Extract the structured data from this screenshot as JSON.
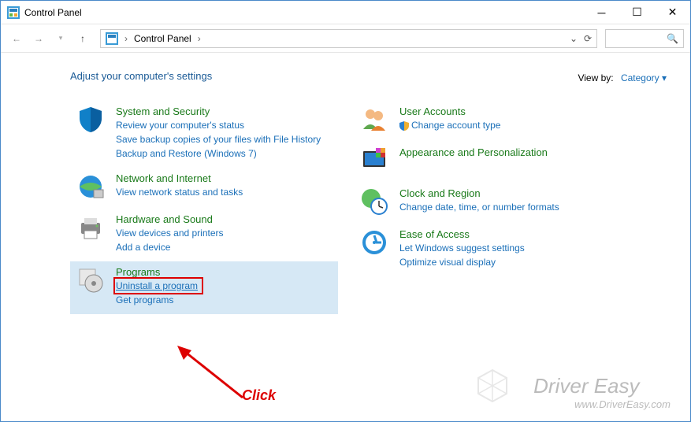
{
  "window_title": "Control Panel",
  "breadcrumb": {
    "root": "Control Panel"
  },
  "heading": "Adjust your computer's settings",
  "viewby": {
    "label": "View by:",
    "value": "Category ▾"
  },
  "left": [
    {
      "title": "System and Security",
      "links": [
        "Review your computer's status",
        "Save backup copies of your files with File History",
        "Backup and Restore (Windows 7)"
      ]
    },
    {
      "title": "Network and Internet",
      "links": [
        "View network status and tasks"
      ]
    },
    {
      "title": "Hardware and Sound",
      "links": [
        "View devices and printers",
        "Add a device"
      ]
    },
    {
      "title": "Programs",
      "links": [
        "Uninstall a program",
        "Get programs"
      ]
    }
  ],
  "right": [
    {
      "title": "User Accounts",
      "links": [
        "Change account type"
      ],
      "shield": true
    },
    {
      "title": "Appearance and Personalization",
      "links": []
    },
    {
      "title": "Clock and Region",
      "links": [
        "Change date, time, or number formats"
      ]
    },
    {
      "title": "Ease of Access",
      "links": [
        "Let Windows suggest settings",
        "Optimize visual display"
      ]
    }
  ],
  "annotation": {
    "label": "Click"
  },
  "watermark": {
    "line1": "Driver Easy",
    "line2": "www.DriverEasy.com"
  }
}
